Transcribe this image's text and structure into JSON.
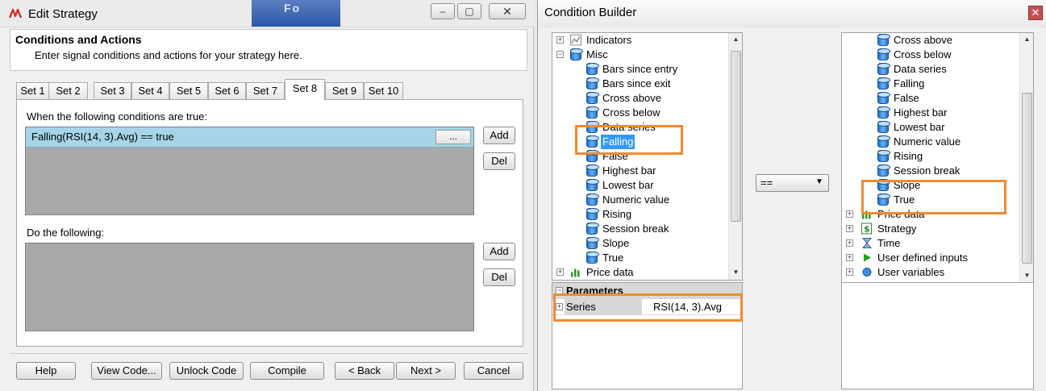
{
  "edit_strategy": {
    "title": "Edit Strategy",
    "window_controls": {
      "minimize": "‒",
      "restore": "▢",
      "close": "✕"
    },
    "header": {
      "title": "Conditions and Actions",
      "subtitle": "Enter signal conditions and actions for your strategy here."
    },
    "tabs": [
      "Set 1",
      "Set 2",
      "Set 3",
      "Set 4",
      "Set 5",
      "Set 6",
      "Set 7",
      "Set 8",
      "Set 9",
      "Set 10"
    ],
    "active_tab": "Set 8",
    "conditions_label": "When the following conditions are true:",
    "condition_row": "Falling(RSI(14, 3).Avg) == true",
    "ellipsis_label": "...",
    "actions_label": "Do the following:",
    "add_label": "Add",
    "del_label": "Del",
    "bottom_buttons": {
      "help": "Help",
      "view_code": "View Code...",
      "unlock_code": "Unlock Code",
      "compile": "Compile",
      "back": "< Back",
      "next": "Next >",
      "cancel": "Cancel"
    }
  },
  "condition_builder": {
    "title": "Condition Builder",
    "close": "✕",
    "left_tree": {
      "indicators": "Indicators",
      "misc": "Misc",
      "misc_items": [
        "Bars since entry",
        "Bars since exit",
        "Cross above",
        "Cross below",
        "Data series",
        "Falling",
        "False",
        "Highest bar",
        "Lowest bar",
        "Numeric value",
        "Rising",
        "Session break",
        "Slope",
        "True"
      ],
      "selected": "Falling",
      "price_data": "Price data"
    },
    "parameters": {
      "header": "Parameters",
      "name": "Series",
      "value": "RSI(14, 3).Avg"
    },
    "operator": "==",
    "right_tree": {
      "misc_items": [
        "Cross above",
        "Cross below",
        "Data series",
        "Falling",
        "False",
        "Highest bar",
        "Lowest bar",
        "Numeric value",
        "Rising",
        "Session break",
        "Slope",
        "True"
      ],
      "groups": [
        "Price data",
        "Strategy",
        "Time",
        "User defined inputs",
        "User variables"
      ]
    }
  },
  "colors": {
    "highlight": "#f28a30",
    "selection": "#3399ff",
    "condition_row": "#a6d5e8",
    "list_background": "#a9a9a9"
  }
}
